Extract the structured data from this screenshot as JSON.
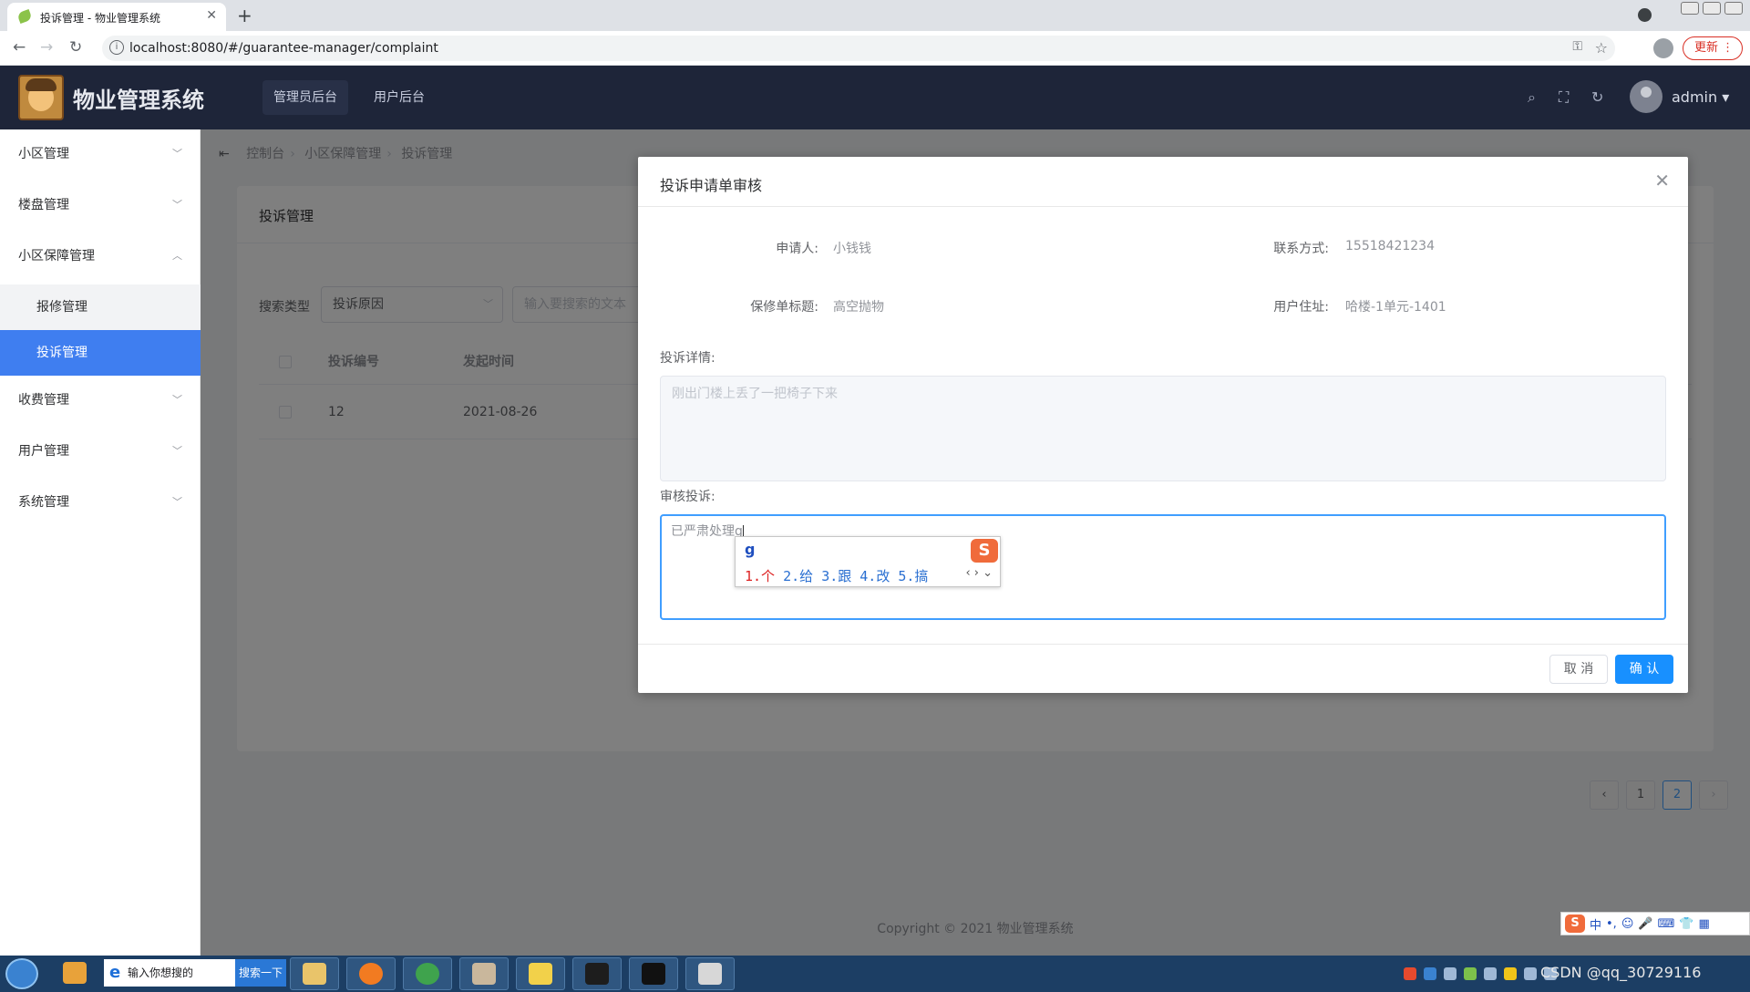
{
  "browser": {
    "tab_title": "投诉管理 - 物业管理系统",
    "url": "localhost:8080/#/guarantee-manager/complaint",
    "update_label": "更新"
  },
  "header": {
    "app_name": "物业管理系统",
    "nav_admin": "管理员后台",
    "nav_user": "用户后台",
    "username": "admin"
  },
  "sidebar": {
    "items": [
      {
        "label": "小区管理"
      },
      {
        "label": "楼盘管理"
      },
      {
        "label": "小区保障管理"
      },
      {
        "label": "报修管理"
      },
      {
        "label": "投诉管理"
      },
      {
        "label": "收费管理"
      },
      {
        "label": "用户管理"
      },
      {
        "label": "系统管理"
      }
    ]
  },
  "breadcrumb": [
    "控制台",
    "小区保障管理",
    "投诉管理"
  ],
  "page": {
    "card_title": "投诉管理",
    "search_type_label": "搜索类型",
    "search_type_value": "投诉原因",
    "search_placeholder": "输入要搜索的文本",
    "columns": [
      "投诉编号",
      "发起时间"
    ],
    "rows": [
      {
        "id": "12",
        "time": "2021-08-26"
      }
    ],
    "pages": [
      "1",
      "2"
    ],
    "current_page": "2",
    "footer": "Copyright © 2021 物业管理系统"
  },
  "dialog": {
    "title": "投诉申请单审核",
    "applicant_label": "申请人:",
    "applicant_value": "小钱钱",
    "contact_label": "联系方式:",
    "contact_value": "15518421234",
    "order_title_label": "保修单标题:",
    "order_title_value": "高空抛物",
    "address_label": "用户住址:",
    "address_value": "哈楼-1单元-1401",
    "detail_label": "投诉详情:",
    "detail_value": "刚出门楼上丢了一把椅子下来",
    "review_label": "审核投诉:",
    "review_value": "已严肃处理g",
    "cancel_label": "取 消",
    "confirm_label": "确 认"
  },
  "ime": {
    "composition": "g",
    "candidates": [
      "1.个",
      "2.给",
      "3.跟",
      "4.改",
      "5.搞"
    ]
  },
  "taskbar": {
    "search_placeholder": "输入你想搜的",
    "search_button": "搜索一下",
    "watermark": "CSDN @qq_30729116"
  }
}
